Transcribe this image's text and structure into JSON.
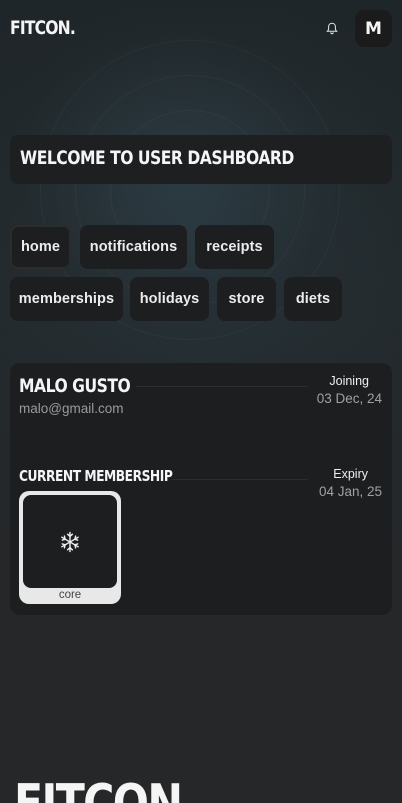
{
  "header": {
    "logo": "FITCON.",
    "avatar_initial": "M",
    "bell_icon": "bell-icon"
  },
  "welcome": {
    "title": "WELCOME TO USER DASHBOARD"
  },
  "nav": {
    "items": [
      {
        "label": "home",
        "active": true
      },
      {
        "label": "notifications"
      },
      {
        "label": "receipts"
      },
      {
        "label": "memberships"
      },
      {
        "label": "holidays"
      },
      {
        "label": "store"
      },
      {
        "label": "diets"
      }
    ]
  },
  "profile": {
    "name": "MALO GUSTO",
    "email": "malo@gmail.com",
    "joining_label": "Joining",
    "joining_date": "03 Dec, 24"
  },
  "membership": {
    "section_title": "CURRENT MEMBERSHIP",
    "expiry_label": "Expiry",
    "expiry_date": "04 Jan, 25",
    "plan_icon": "snowflake-icon",
    "plan_label": "core"
  },
  "footer": {
    "logo": "FITCON."
  },
  "colors": {
    "background": "#252729",
    "card": "#1d1e1f",
    "text": "#f1f1f1",
    "muted": "#9a9b9d",
    "tile": "#e8e8e8"
  }
}
